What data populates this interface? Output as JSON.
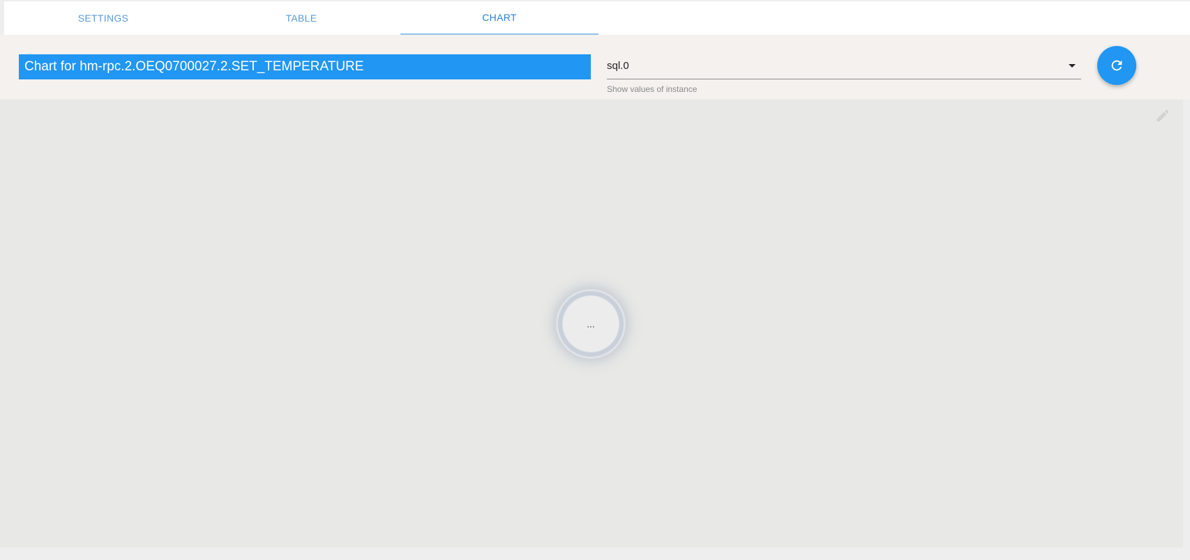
{
  "tabs": [
    {
      "label": "SETTINGS",
      "active": false
    },
    {
      "label": "TABLE",
      "active": false
    },
    {
      "label": "CHART",
      "active": true
    }
  ],
  "toolbar": {
    "chart_title": "Chart for hm-rpc.2.OEQ0700027.2.SET_TEMPERATURE",
    "instance_select": {
      "value": "sql.0",
      "helper_text": "Show values of instance"
    },
    "refresh_icon": "refresh-icon"
  },
  "chart": {
    "loading_text": "...",
    "edit_icon": "pencil-icon"
  },
  "colors": {
    "accent": "#2196f3",
    "tab_text": "#5b9bd5",
    "chart_bg": "#e8e8e6",
    "toolbar_bg": "#f4f1ee"
  }
}
